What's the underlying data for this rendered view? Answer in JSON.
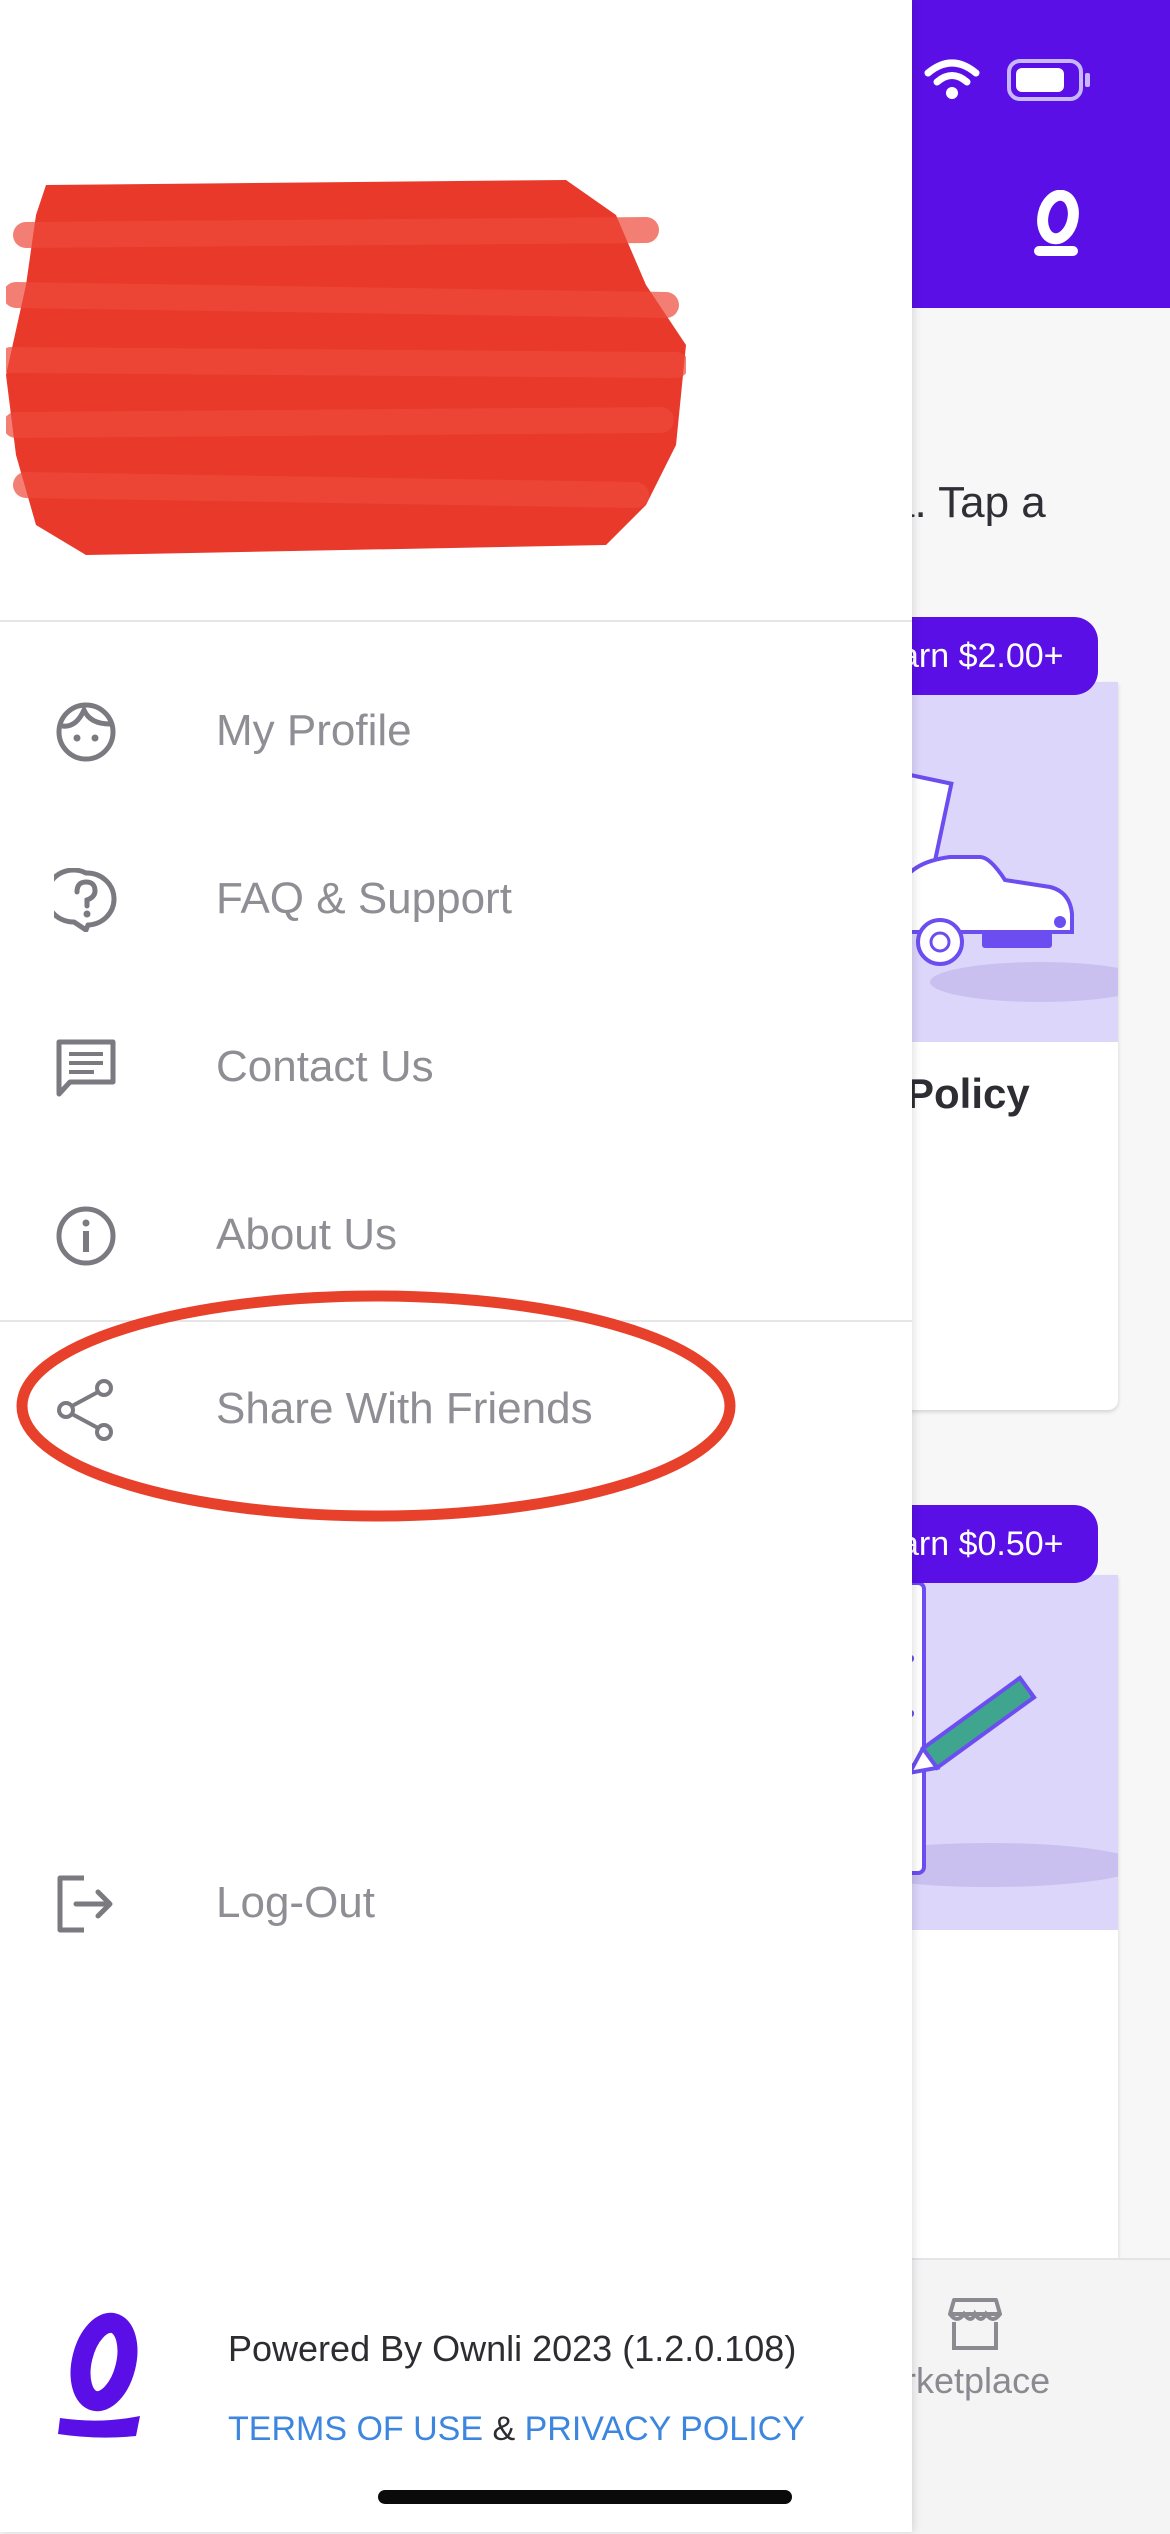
{
  "background": {
    "intro_text": "a. Tap a",
    "cards": [
      {
        "badge": "arn $2.00+",
        "title": "Policy"
      },
      {
        "badge": "arn $0.50+"
      }
    ],
    "bottom_nav": {
      "marketplace_label": "arketplace"
    }
  },
  "drawer": {
    "menu": [
      {
        "label": "My Profile",
        "icon": "face-icon"
      },
      {
        "label": "FAQ & Support",
        "icon": "help-bubble-icon"
      },
      {
        "label": "Contact Us",
        "icon": "chat-icon"
      },
      {
        "label": "About Us",
        "icon": "info-icon"
      },
      {
        "label": "Share With Friends",
        "icon": "share-icon"
      },
      {
        "label": "Log-Out",
        "icon": "logout-icon"
      }
    ],
    "footer": {
      "powered_by": "Powered By Ownli 2023 (1.2.0.108)",
      "terms_label": "TERMS OF USE",
      "ampersand": " & ",
      "privacy_label": "PRIVACY POLICY"
    }
  },
  "colors": {
    "brand_purple": "#5a0fe6",
    "link_blue": "#3d86e0",
    "annotation_red": "#e8412b",
    "menu_text": "#8e8e94"
  }
}
